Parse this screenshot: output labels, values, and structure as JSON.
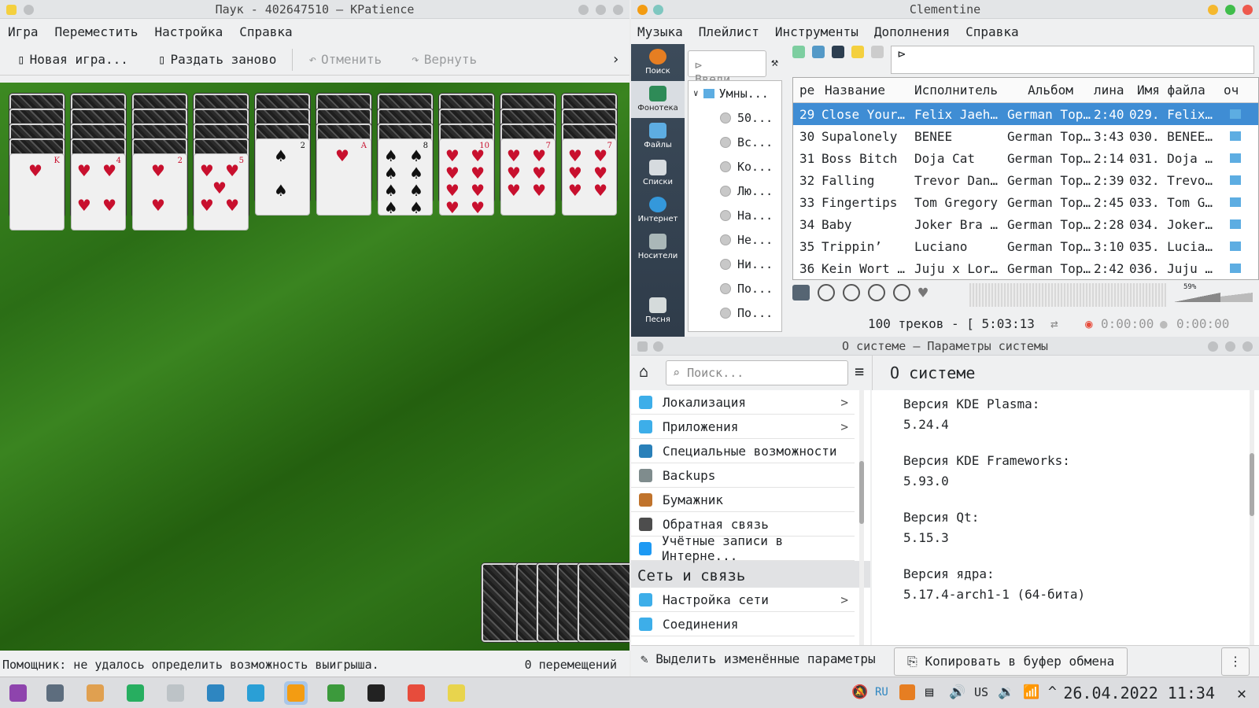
{
  "kpatience": {
    "title": "Паук - 402647510 — KPatience",
    "menu": [
      "Игра",
      "Переместить",
      "Настройка",
      "Справка"
    ],
    "toolbar": {
      "new_game": "Новая игра...",
      "redeal": "Раздать заново",
      "undo": "Отменить",
      "redo": "Вернуть"
    },
    "columns": [
      {
        "backs": 4,
        "rank": "K",
        "suit": "♥",
        "color": "red",
        "pips": "♥"
      },
      {
        "backs": 4,
        "rank": "4",
        "suit": "♥",
        "color": "red",
        "pips": "♥ ♥\n\n♥ ♥"
      },
      {
        "backs": 4,
        "rank": "2",
        "suit": "♥",
        "color": "red",
        "pips": "♥\n\n♥"
      },
      {
        "backs": 4,
        "rank": "5",
        "suit": "♥",
        "color": "red",
        "pips": "♥ ♥\n♥\n♥ ♥"
      },
      {
        "backs": 3,
        "rank": "2",
        "suit": "♠",
        "color": "blk",
        "pips": "♠\n\n♠"
      },
      {
        "backs": 3,
        "rank": "A",
        "suit": "♥",
        "color": "red",
        "pips": "♥"
      },
      {
        "backs": 3,
        "rank": "8",
        "suit": "♠",
        "color": "blk",
        "pips": "♠ ♠\n♠ ♠\n♠ ♠\n♠ ♠"
      },
      {
        "backs": 3,
        "rank": "10",
        "suit": "♥",
        "color": "red",
        "pips": "♥ ♥\n♥ ♥\n♥ ♥\n♥ ♥"
      },
      {
        "backs": 3,
        "rank": "7",
        "suit": "♥",
        "color": "red",
        "pips": "♥ ♥\n♥ ♥\n♥ ♥"
      },
      {
        "backs": 3,
        "rank": "7",
        "suit": "♥",
        "color": "red",
        "pips": "♥ ♥\n♥ ♥\n♥ ♥"
      }
    ],
    "stock_count": 5,
    "status_left": "Помощник: не удалось определить возможность выигрыша.",
    "status_right": "0 перемещений"
  },
  "clementine": {
    "title": "Clementine",
    "menu": [
      "Музыка",
      "Плейлист",
      "Инструменты",
      "Дополнения",
      "Справка"
    ],
    "sidebar": [
      "Поиск",
      "Фонотека",
      "Файлы",
      "Списки",
      "Интернет",
      "Носители",
      "Песня"
    ],
    "search_placeholder": "Введи...",
    "tree_root": "Умны...",
    "tree_items": [
      "50...",
      "Вс...",
      "Ко...",
      "Лю...",
      "На...",
      "Не...",
      "Ни...",
      "По...",
      "По..."
    ],
    "playlist_headers": [
      "ре",
      "Название",
      "Исполнитель",
      "Альбом",
      "лина",
      "Имя файла",
      "оч"
    ],
    "rows": [
      [
        "29",
        "Close Your…",
        "Felix Jaeh…",
        "German Top…",
        "2:40",
        "029. Felix…"
      ],
      [
        "30",
        "Supalonely",
        "BENEE",
        "German Top…",
        "3:43",
        "030. BENEE…"
      ],
      [
        "31",
        "Boss Bitch",
        "Doja Cat",
        "German Top…",
        "2:14",
        "031. Doja …"
      ],
      [
        "32",
        "Falling",
        "Trevor Dan…",
        "German Top…",
        "2:39",
        "032. Trevo…"
      ],
      [
        "33",
        "Fingertips",
        "Tom Gregory",
        "German Top…",
        "2:45",
        "033. Tom G…"
      ],
      [
        "34",
        "Baby",
        "Joker Bra …",
        "German Top…",
        "2:28",
        "034. Joker…"
      ],
      [
        "35",
        "Trippin’",
        "Luciano",
        "German Top…",
        "3:10",
        "035. Lucia…"
      ],
      [
        "36",
        "Kein Wort …",
        "Juju x Lor…",
        "German Top…",
        "2:42",
        "036. Juju …"
      ]
    ],
    "volume": "59%",
    "status": "100 треков - [ 5:03:13",
    "time_elapsed": "0:00:00",
    "time_total": "0:00:00"
  },
  "settings": {
    "title": "О системе — Параметры системы",
    "search_placeholder": "Поиск...",
    "items": [
      {
        "label": "Локализация",
        "arrow": ">",
        "color": "#3daee9"
      },
      {
        "label": "Приложения",
        "arrow": ">",
        "color": "#3daee9"
      },
      {
        "label": "Специальные возможности",
        "arrow": "",
        "color": "#2980b9"
      },
      {
        "label": "Backups",
        "arrow": "",
        "color": "#7f8c8d"
      },
      {
        "label": "Бумажник",
        "arrow": "",
        "color": "#c0732c"
      },
      {
        "label": "Обратная связь",
        "arrow": "",
        "color": "#4d4d4d"
      },
      {
        "label": "Учётные записи в Интерне...",
        "arrow": "",
        "color": "#1d99f3"
      }
    ],
    "category": "Сеть и связь",
    "items2": [
      {
        "label": "Настройка сети",
        "arrow": ">",
        "color": "#3daee9"
      },
      {
        "label": "Соединения",
        "arrow": "",
        "color": "#3daee9"
      }
    ],
    "page_title": "О системе",
    "info": [
      {
        "key": "Версия KDE Plasma:",
        "value": "5.24.4"
      },
      {
        "key": "Версия KDE Frameworks:",
        "value": "5.93.0"
      },
      {
        "key": "Версия Qt:",
        "value": "5.15.3"
      },
      {
        "key": "Версия ядра:",
        "value": "5.17.4-arch1-1 (64-бита)"
      }
    ],
    "highlight_btn": "Выделить изменённые параметры",
    "copy_btn": "Копировать в буфер обмена",
    "more": "⋮"
  },
  "taskbar": {
    "apps": [
      {
        "name": "app-launcher",
        "color": "#8e44ad"
      },
      {
        "name": "toggle",
        "color": "#5d6d7e"
      },
      {
        "name": "files",
        "color": "#e0a050"
      },
      {
        "name": "sync",
        "color": "#27ae60"
      },
      {
        "name": "sublime",
        "color": "#bdc3c7"
      },
      {
        "name": "mail",
        "color": "#2e86c1"
      },
      {
        "name": "telegram",
        "color": "#2a9fd6"
      },
      {
        "name": "clementine",
        "color": "#f39c12"
      },
      {
        "name": "chromium",
        "color": "#3c9a3c"
      },
      {
        "name": "terminal",
        "color": "#222"
      },
      {
        "name": "kpatience",
        "color": "#e74c3c"
      },
      {
        "name": "notes",
        "color": "#e8d44d"
      }
    ],
    "lang": "RU",
    "layout": "US",
    "clock": "26.04.2022 11:34"
  }
}
